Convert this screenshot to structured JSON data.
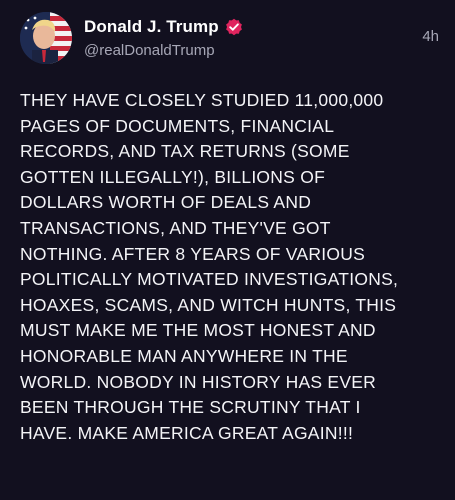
{
  "post": {
    "author": {
      "display_name": "Donald J. Trump",
      "handle": "@realDonaldTrump",
      "verified": true,
      "avatar_icon": "profile-avatar",
      "badge_icon": "verified-badge-icon",
      "badge_color": "#e0245e"
    },
    "timestamp": "4h",
    "body_lines": [
      "THEY HAVE CLOSELY STUDIED 11,000,000",
      "PAGES OF DOCUMENTS, FINANCIAL",
      "RECORDS, AND TAX RETURNS (SOME",
      "GOTTEN ILLEGALLY!), BILLIONS OF",
      "DOLLARS WORTH OF DEALS AND",
      "TRANSACTIONS, AND THEY'VE GOT",
      "NOTHING. AFTER 8 YEARS OF VARIOUS",
      "POLITICALLY MOTIVATED INVESTIGATIONS,",
      "HOAXES, SCAMS, AND WITCH HUNTS, THIS",
      "MUST MAKE ME THE MOST HONEST AND",
      "HONORABLE MAN ANYWHERE IN THE",
      "WORLD. NOBODY IN HISTORY HAS EVER",
      "BEEN THROUGH THE SCRUTINY THAT I",
      "HAVE. MAKE AMERICA GREAT AGAIN!!!"
    ]
  },
  "colors": {
    "background": "#12101f",
    "text_primary": "#ffffff",
    "text_secondary": "#a7a7b6"
  }
}
